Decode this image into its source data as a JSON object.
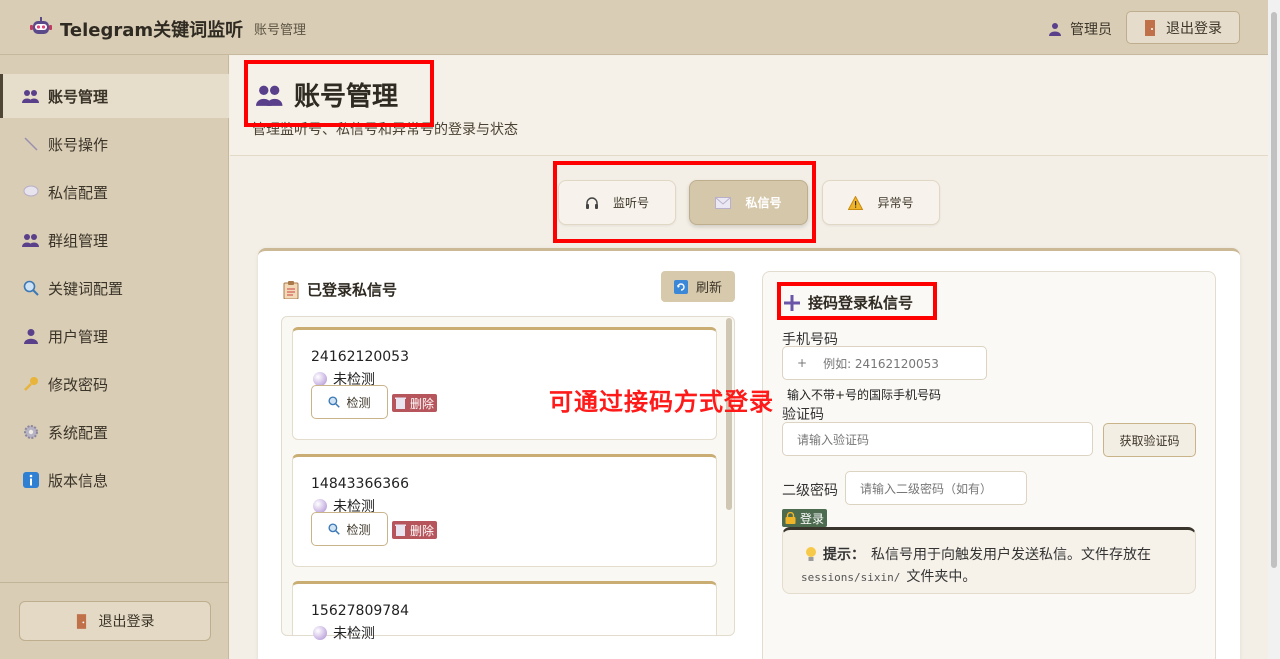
{
  "header": {
    "app_title": "Telegram关键词监听",
    "breadcrumb": "账号管理",
    "user_label": "管理员",
    "logout_label": "退出登录"
  },
  "sidebar": {
    "items": [
      {
        "label": "账号管理",
        "icon": "users-icon",
        "active": true
      },
      {
        "label": "账号操作",
        "icon": "wand-icon"
      },
      {
        "label": "私信配置",
        "icon": "chat-bubble-icon"
      },
      {
        "label": "群组管理",
        "icon": "group-icon"
      },
      {
        "label": "关键词配置",
        "icon": "search-icon"
      },
      {
        "label": "用户管理",
        "icon": "user-icon"
      },
      {
        "label": "修改密码",
        "icon": "key-icon"
      },
      {
        "label": "系统配置",
        "icon": "gear-icon"
      },
      {
        "label": "版本信息",
        "icon": "info-icon"
      }
    ],
    "logout_label": "退出登录"
  },
  "page": {
    "title": "账号管理",
    "subtitle": "管理监听号、私信号和异常号的登录与状态"
  },
  "tabs": [
    {
      "label": "监听号",
      "icon": "headphones-icon"
    },
    {
      "label": "私信号",
      "icon": "envelope-icon",
      "active": true
    },
    {
      "label": "异常号",
      "icon": "warning-icon"
    }
  ],
  "accounts_panel": {
    "title": "已登录私信号",
    "refresh_label": "刷新",
    "check_label": "检测",
    "delete_label": "删除",
    "accounts": [
      {
        "phone": "24162120053",
        "status": "未检测"
      },
      {
        "phone": "14843366366",
        "status": "未检测"
      },
      {
        "phone": "15627809784",
        "status": "未检测"
      }
    ]
  },
  "login_panel": {
    "title": "接码登录私信号",
    "phone_label": "手机号码",
    "phone_prefix": "+",
    "phone_placeholder": "例如: 24162120053",
    "phone_hint": "输入不带+号的国际手机号码",
    "code_label": "验证码",
    "code_placeholder": "请输入验证码",
    "get_code_label": "获取验证码",
    "password_label": "二级密码",
    "password_placeholder": "请输入二级密码（如有）",
    "login_label": "登录",
    "tip_label": "提示：",
    "tip_text": "私信号用于向触发用户发送私信。文件存放在",
    "tip_path": "sessions/sixin/",
    "tip_suffix": "文件夹中。"
  },
  "annotation": "可通过接码方式登录",
  "colors": {
    "accent": "#d5c7aa",
    "annotation_red": "#ff0000",
    "delete": "#b6555b",
    "login": "#4c6b4f"
  }
}
